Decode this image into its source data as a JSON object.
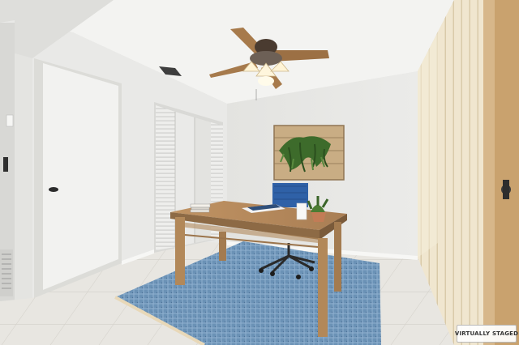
{
  "watermark": {
    "text": "VIRTUALLY STAGED"
  },
  "colors": {
    "wall": "#ececea",
    "ceiling": "#f4f4f2",
    "floor": "#e6e4df",
    "rug": "#6f95b8",
    "desk": "#b48a5e",
    "chair": "#2f63a8",
    "blinds": "#efe4cc"
  },
  "icons": {
    "ceiling_fan": "ceiling-fan-icon",
    "plant": "plant-icon"
  }
}
